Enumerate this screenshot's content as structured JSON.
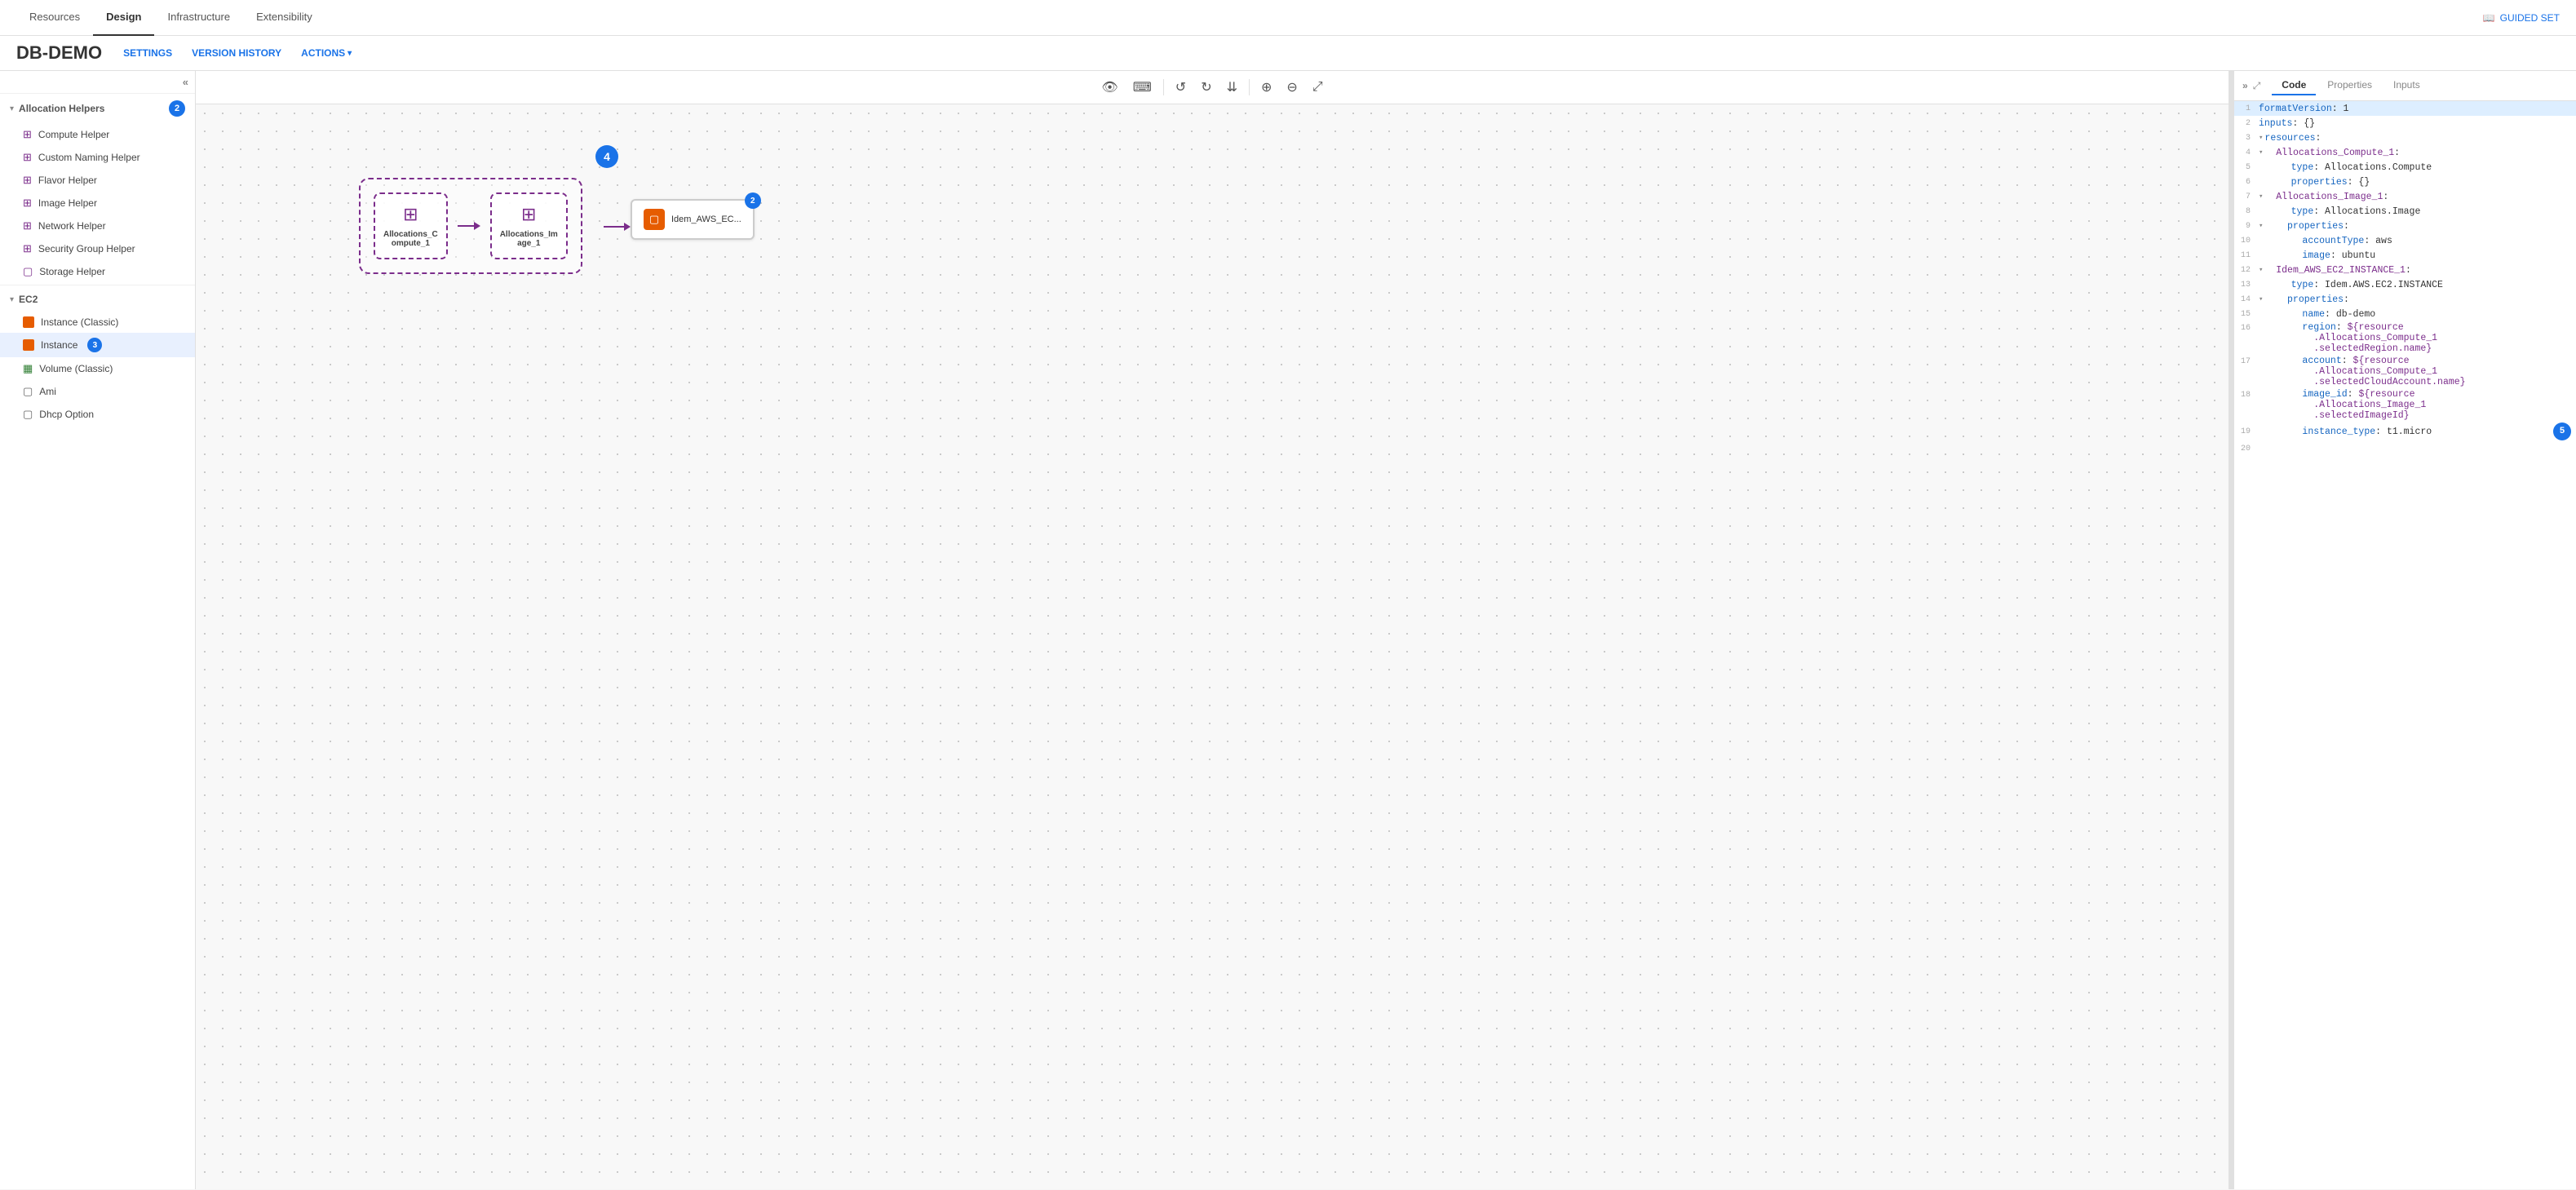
{
  "topNav": {
    "items": [
      {
        "id": "resources",
        "label": "Resources",
        "active": false
      },
      {
        "id": "design",
        "label": "Design",
        "active": true
      },
      {
        "id": "infrastructure",
        "label": "Infrastructure",
        "active": false
      },
      {
        "id": "extensibility",
        "label": "Extensibility",
        "active": false
      }
    ],
    "guidedSet": "GUIDED SET"
  },
  "subHeader": {
    "title": "DB-DEMO",
    "navItems": [
      {
        "id": "settings",
        "label": "SETTINGS"
      },
      {
        "id": "versionHistory",
        "label": "VERSION HISTORY"
      },
      {
        "id": "actions",
        "label": "ACTIONS",
        "hasArrow": true
      }
    ]
  },
  "sidebar": {
    "collapseLabel": "<<",
    "allocationHelpers": {
      "label": "Allocation Helpers",
      "badge": "2",
      "items": [
        {
          "id": "compute-helper",
          "label": "Compute Helper",
          "iconType": "alloc"
        },
        {
          "id": "custom-naming-helper",
          "label": "Custom Naming Helper",
          "iconType": "alloc"
        },
        {
          "id": "flavor-helper",
          "label": "Flavor Helper",
          "iconType": "alloc"
        },
        {
          "id": "image-helper",
          "label": "Image Helper",
          "iconType": "alloc"
        },
        {
          "id": "network-helper",
          "label": "Network Helper",
          "iconType": "alloc"
        },
        {
          "id": "security-group-helper",
          "label": "Security Group Helper",
          "iconType": "alloc"
        },
        {
          "id": "storage-helper",
          "label": "Storage Helper",
          "iconType": "box"
        }
      ]
    },
    "ec2": {
      "label": "EC2",
      "items": [
        {
          "id": "instance-classic",
          "label": "Instance (Classic)",
          "iconType": "orange-box"
        },
        {
          "id": "instance",
          "label": "Instance",
          "iconType": "orange-box",
          "badge": "3"
        },
        {
          "id": "volume-classic",
          "label": "Volume (Classic)",
          "iconType": "green-table"
        },
        {
          "id": "ami",
          "label": "Ami",
          "iconType": "box"
        },
        {
          "id": "dhcp-option",
          "label": "Dhcp Option",
          "iconType": "box"
        }
      ]
    }
  },
  "canvas": {
    "nodes": {
      "alloc1": {
        "label": "Allocations_C\nompute_1"
      },
      "alloc2": {
        "label": "Allocations_Im\nage_1"
      },
      "instance": {
        "label": "Idem_AWS_EC...",
        "badge": "2"
      }
    },
    "badge4": "4"
  },
  "codePanel": {
    "expandIcons": [
      ">>",
      "⤢"
    ],
    "tabs": [
      {
        "id": "code",
        "label": "Code",
        "active": true
      },
      {
        "id": "properties",
        "label": "Properties",
        "active": false
      },
      {
        "id": "inputs",
        "label": "Inputs",
        "active": false
      }
    ],
    "lines": [
      {
        "num": 1,
        "content": "formatVersion: 1",
        "highlight": true
      },
      {
        "num": 2,
        "content": "inputs: {}"
      },
      {
        "num": 3,
        "content": "resources:",
        "collapse": true
      },
      {
        "num": 4,
        "content": "  Allocations_Compute_1:",
        "collapse": true,
        "indent": "  ",
        "key": "Allocations_Compute_1:"
      },
      {
        "num": 5,
        "content": "    type: Allocations.Compute"
      },
      {
        "num": 6,
        "content": "    properties: {}"
      },
      {
        "num": 7,
        "content": "  Allocations_Image_1:",
        "collapse": true,
        "indent": "  ",
        "key": "Allocations_Image_1:"
      },
      {
        "num": 8,
        "content": "    type: Allocations.Image"
      },
      {
        "num": 9,
        "content": "    properties:",
        "collapse": true
      },
      {
        "num": 10,
        "content": "      accountType: aws"
      },
      {
        "num": 11,
        "content": "      image: ubuntu"
      },
      {
        "num": 12,
        "content": "  Idem_AWS_EC2_INSTANCE_1:",
        "collapse": true,
        "indent": "  ",
        "key": "Idem_AWS_EC2_INSTANCE_1:"
      },
      {
        "num": 13,
        "content": "    type: Idem.AWS.EC2.INSTANCE"
      },
      {
        "num": 14,
        "content": "    properties:",
        "collapse": true
      },
      {
        "num": 15,
        "content": "      name: db-demo"
      },
      {
        "num": 16,
        "content": "      region: ${resource\n        .Allocations_Compute_1\n        .selectedRegion.name}"
      },
      {
        "num": 17,
        "content": "      account: ${resource\n        .Allocations_Compute_1\n        .selectedCloudAccount.name}"
      },
      {
        "num": 18,
        "content": "      image_id: ${resource\n        .Allocations_Image_1\n        .selectedImageId}"
      },
      {
        "num": 19,
        "content": "      instance_type: t1.micro"
      },
      {
        "num": 20,
        "content": ""
      }
    ],
    "badge5": "5"
  }
}
